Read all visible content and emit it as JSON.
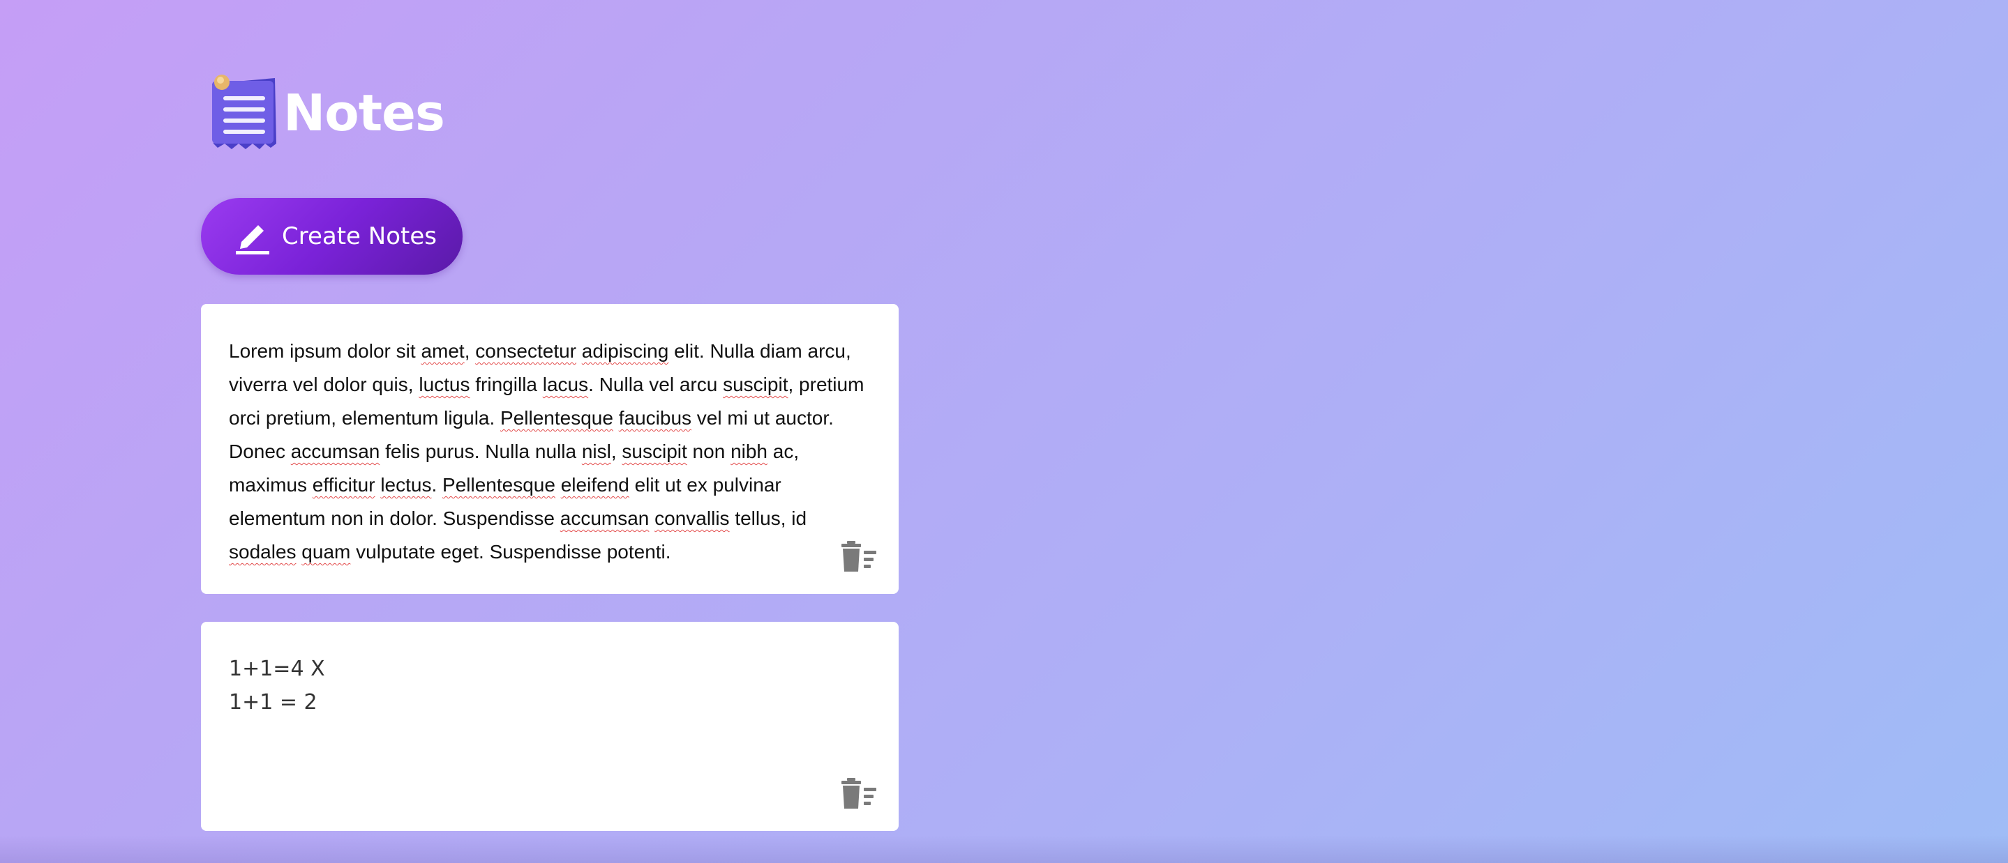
{
  "header": {
    "title": "Notes",
    "logo_icon": "notepad-icon"
  },
  "toolbar": {
    "create_label": "Create Notes",
    "create_icon": "pencil-icon"
  },
  "notes": [
    {
      "segments": [
        "Lorem ipsum dolor sit ",
        "amet",
        ", ",
        "consectetur",
        " ",
        "adipiscing",
        " elit. Nulla diam arcu,\nviverra vel dolor quis, ",
        "luctus",
        " fringilla ",
        "lacus",
        ". Nulla vel arcu ",
        "suscipit",
        ", pretium\norci pretium, elementum ligula. ",
        "Pellentesque",
        " ",
        "faucibus",
        " vel mi ut auctor.\nDonec ",
        "accumsan",
        " felis purus. Nulla nulla ",
        "nisl",
        ", ",
        "suscipit",
        " non ",
        "nibh",
        " ac,\nmaximus ",
        "efficitur",
        " ",
        "lectus",
        ". ",
        "Pellentesque",
        " ",
        "eleifend",
        " elit ut ex pulvinar\nelementum non in dolor. Suspendisse ",
        "accumsan",
        " ",
        "convallis",
        " tellus, id\n",
        "sodales",
        " ",
        "quam",
        " vulputate eget. Suspendisse potenti."
      ],
      "delete_icon": "trash-icon"
    },
    {
      "text": "1+1=4 X\n1+1 = 2",
      "delete_icon": "trash-icon"
    }
  ],
  "colors": {
    "accent": "#7a22d8",
    "spellcheck": "#e34b4b",
    "icon": "#7a7a7a"
  }
}
